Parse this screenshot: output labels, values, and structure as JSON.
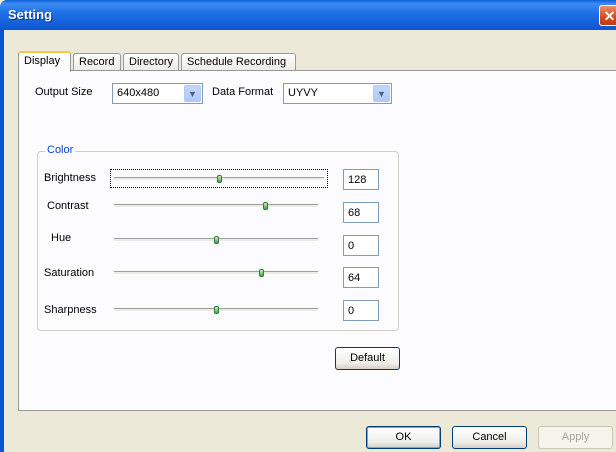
{
  "window": {
    "title": "Setting",
    "close_glyph": "✕"
  },
  "tabs": [
    "Display",
    "Record",
    "Directory",
    "Schedule Recording"
  ],
  "output_size": {
    "label": "Output Size",
    "value": "640x480"
  },
  "data_format": {
    "label": "Data Format",
    "value": "UYVY"
  },
  "color_group": {
    "legend": "Color",
    "sliders": [
      {
        "label": "Brightness",
        "value": "128",
        "level": 0.5
      },
      {
        "label": "Contrast",
        "value": "68",
        "level": 0.75
      },
      {
        "label": "Hue",
        "value": "0",
        "level": 0.5
      },
      {
        "label": "Saturation",
        "value": "64",
        "level": 0.73
      },
      {
        "label": "Sharpness",
        "value": "0",
        "level": 0.5
      }
    ]
  },
  "buttons": {
    "default": "Default",
    "ok": "OK",
    "cancel": "Cancel",
    "apply": "Apply"
  }
}
